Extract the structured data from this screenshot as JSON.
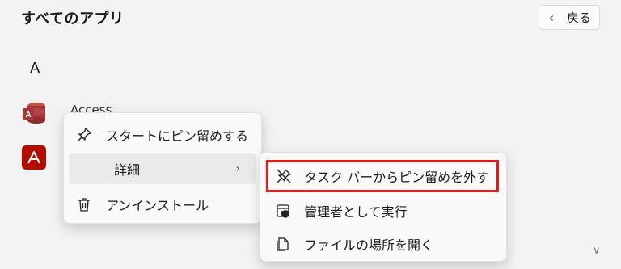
{
  "header": {
    "title": "すべてのアプリ",
    "back_label": "戻る"
  },
  "app_list": {
    "group_letter": "A",
    "apps": [
      {
        "name": "Access",
        "icon": "access-icon"
      },
      {
        "name": "",
        "icon": "acrobat-icon"
      }
    ]
  },
  "context_menu": {
    "items": [
      {
        "label": "スタートにピン留めする",
        "icon": "pin-icon"
      },
      {
        "label": "詳細",
        "icon": "chevron-right-icon"
      },
      {
        "label": "アンインストール",
        "icon": "trash-icon"
      }
    ]
  },
  "submenu": {
    "items": [
      {
        "label": "タスク バーからピン留めを外す",
        "icon": "unpin-icon"
      },
      {
        "label": "管理者として実行",
        "icon": "shield-icon"
      },
      {
        "label": "ファイルの場所を開く",
        "icon": "folder-open-icon"
      }
    ]
  },
  "colors": {
    "highlight_border": "#e21a1a",
    "access_red": "#a4373a",
    "acrobat_red": "#b30b00"
  }
}
